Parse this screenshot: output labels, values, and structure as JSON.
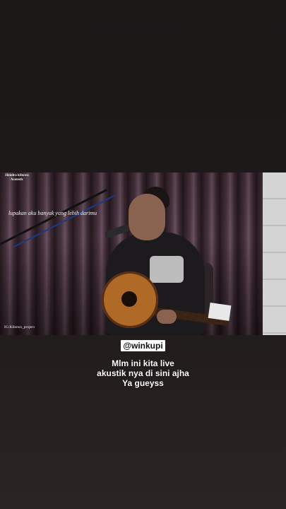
{
  "video": {
    "brand_line1": "Hendra kibowo",
    "brand_line2": "Acoustic",
    "lyric_overlay": "lupakan aku banyak yang lebih darimu",
    "instagram": "IG:Kibowo_project"
  },
  "post": {
    "handle": "@winkupi",
    "caption_lines": [
      "Mlm ini kita live",
      "akustik nya di sini ajha",
      "Ya gueyss"
    ]
  }
}
